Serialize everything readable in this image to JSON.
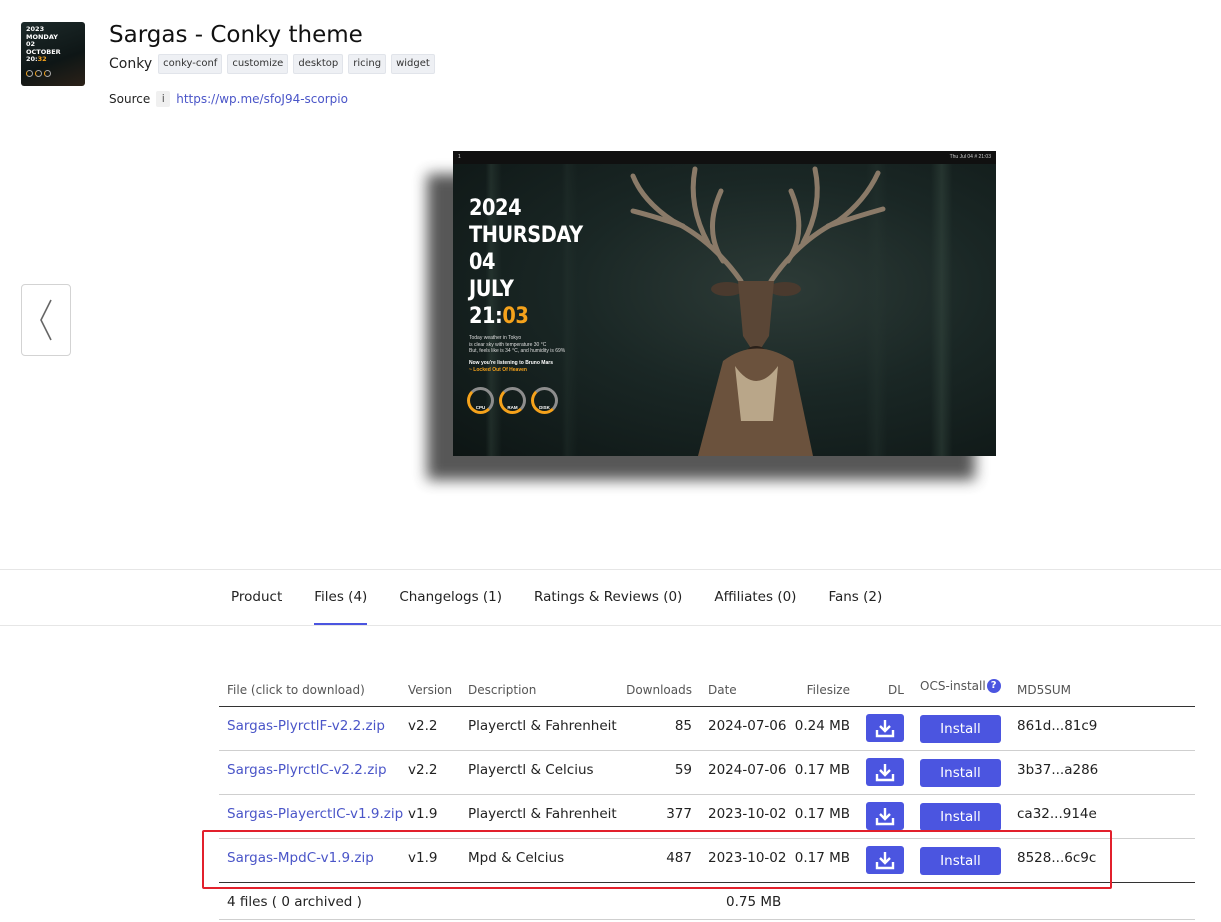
{
  "product": {
    "title": "Sargas - Conky theme",
    "category": "Conky",
    "tags": [
      "conky-conf",
      "customize",
      "desktop",
      "ricing",
      "widget"
    ],
    "source_label": "Source",
    "source_info": "i",
    "source_url": "https://wp.me/sfoJ94-scorpio",
    "logo": {
      "lines": [
        "2023",
        "MONDAY",
        "02",
        "OCTOBER",
        "20:"
      ],
      "minutes": "32"
    }
  },
  "preview": {
    "topbar_left": "1",
    "topbar_right": "Thu Jul 04 # 21:03",
    "clock_lines": [
      "2024",
      "THURSDAY",
      "04",
      "JULY"
    ],
    "clock_hour": "21:",
    "clock_minute": "03",
    "weather": [
      "Today weather in Tokyo",
      "is clear sky with temperature 30 °C",
      "But, feels like is 34 °C, and humidity is 69%"
    ],
    "music_line": "Now you're listening to Bruno Mars",
    "music_song": "~ Locked Out Of Heaven",
    "gauges": [
      "CPU",
      "RAM",
      "DISK"
    ],
    "accent": "#f5a21b"
  },
  "prev_arrow": "〈",
  "tabs": [
    {
      "label": "Product",
      "active": false
    },
    {
      "label": "Files (4)",
      "active": true
    },
    {
      "label": "Changelogs (1)",
      "active": false
    },
    {
      "label": "Ratings & Reviews (0)",
      "active": false
    },
    {
      "label": "Affiliates (0)",
      "active": false
    },
    {
      "label": "Fans (2)",
      "active": false
    }
  ],
  "files_table": {
    "headers": {
      "file": "File (click to download)",
      "version": "Version",
      "description": "Description",
      "downloads": "Downloads",
      "date": "Date",
      "filesize": "Filesize",
      "dl": "DL",
      "ocs": "OCS-install",
      "ocs_help": "?",
      "md5": "MD5SUM"
    },
    "install_label": "Install",
    "rows": [
      {
        "file": "Sargas-PlyrctlF-v2.2.zip",
        "version": "v2.2",
        "description": "Playerctl & Fahrenheit",
        "downloads": "85",
        "date": "2024-07-06",
        "filesize": "0.24 MB",
        "md5": "861d...81c9"
      },
      {
        "file": "Sargas-PlyrctlC-v2.2.zip",
        "version": "v2.2",
        "description": "Playerctl & Celcius",
        "downloads": "59",
        "date": "2024-07-06",
        "filesize": "0.17 MB",
        "md5": "3b37...a286"
      },
      {
        "file": "Sargas-PlayerctlC-v1.9.zip",
        "version": "v1.9",
        "description": "Playerctl & Fahrenheit",
        "downloads": "377",
        "date": "2023-10-02",
        "filesize": "0.17 MB",
        "md5": "ca32...914e"
      },
      {
        "file": "Sargas-MpdC-v1.9.zip",
        "version": "v1.9",
        "description": "Mpd & Celcius",
        "downloads": "487",
        "date": "2023-10-02",
        "filesize": "0.17 MB",
        "md5": "8528...6c9c"
      }
    ],
    "footer_count": "4 files ( 0 archived )",
    "footer_total": "0.75 MB"
  },
  "colors": {
    "primary": "#4b55e0",
    "link": "#4a55c8",
    "highlight": "#e2202c"
  }
}
